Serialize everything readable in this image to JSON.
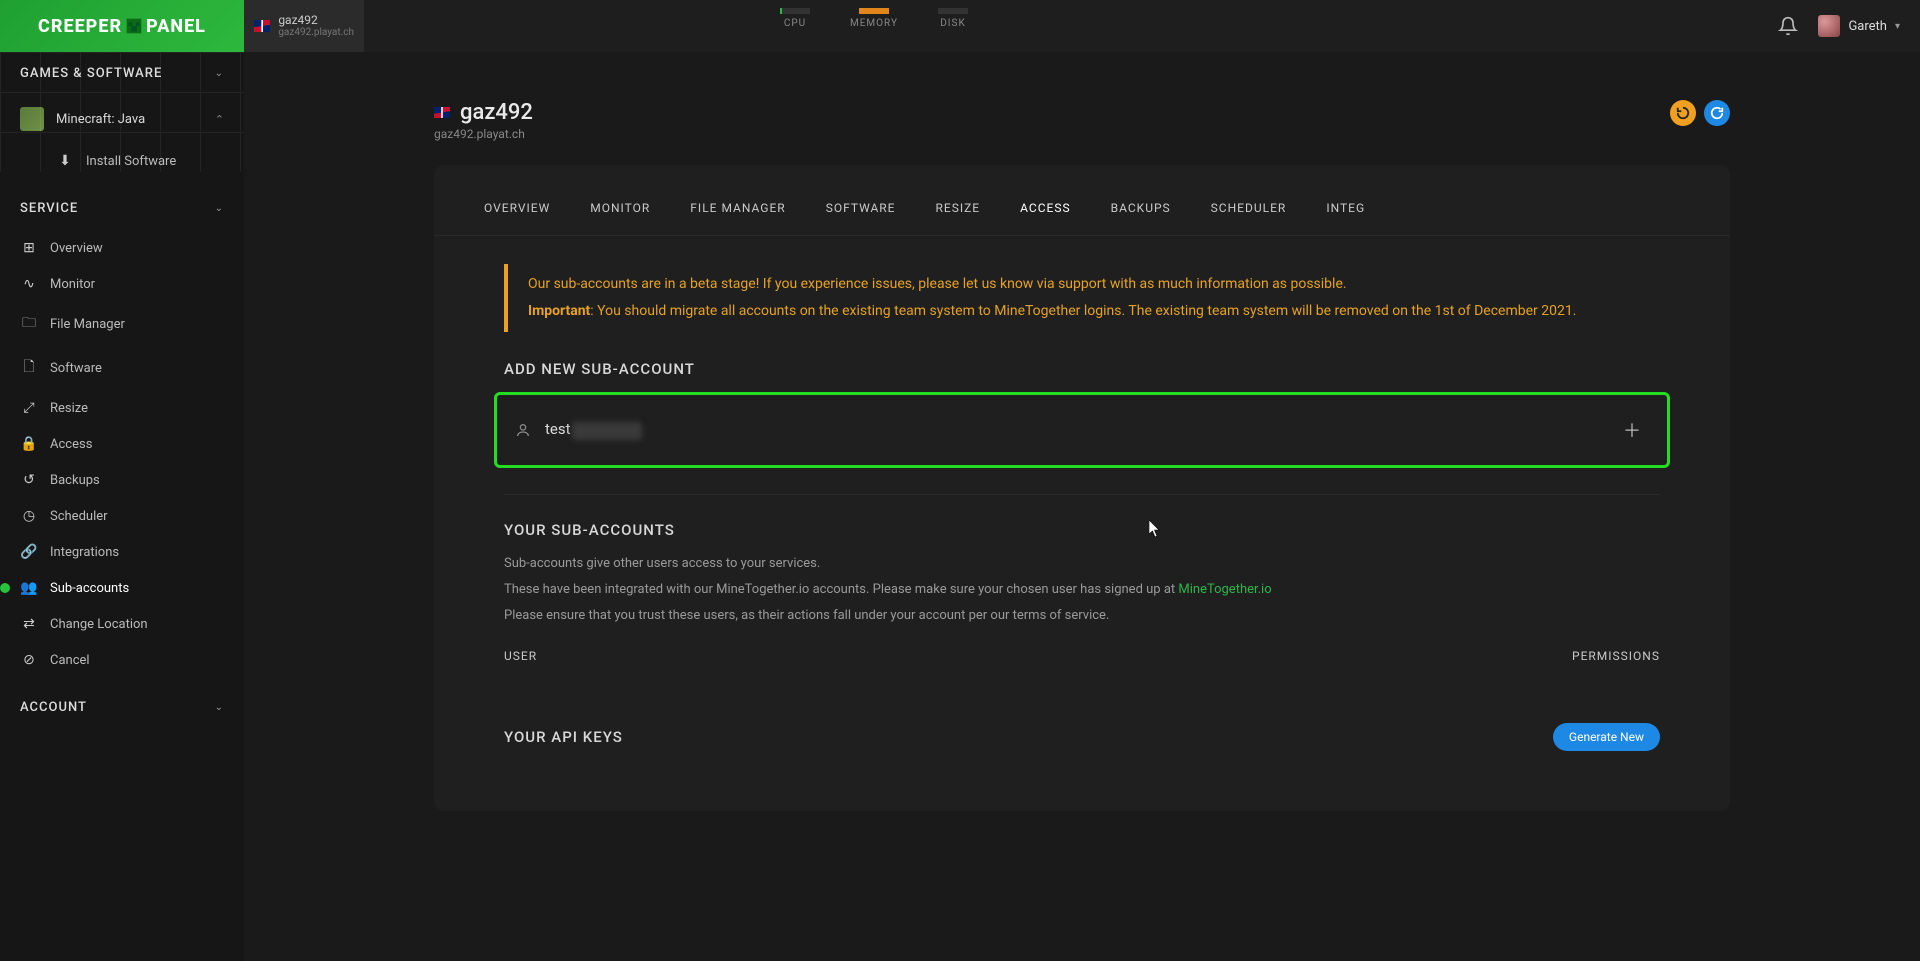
{
  "brand": {
    "part1": "CREEPER",
    "part2": "PANEL"
  },
  "serverChip": {
    "name": "gaz492",
    "address": "gaz492.playat.ch"
  },
  "metrics": {
    "cpu": "CPU",
    "memory": "MEMORY",
    "disk": "DISK"
  },
  "topUser": {
    "name": "Gareth"
  },
  "sidebar": {
    "sections": {
      "games": "GAMES & SOFTWARE",
      "service": "SERVICE",
      "account": "ACCOUNT"
    },
    "game": {
      "name": "Minecraft: Java"
    },
    "install": "Install Software",
    "service_items": [
      {
        "icon": "⊞",
        "label": "Overview",
        "name": "overview"
      },
      {
        "icon": "∿",
        "label": "Monitor",
        "name": "monitor"
      },
      {
        "icon": "🗀",
        "label": "File Manager",
        "name": "file-manager"
      },
      {
        "icon": "🗋",
        "label": "Software",
        "name": "software"
      },
      {
        "icon": "⤢",
        "label": "Resize",
        "name": "resize"
      },
      {
        "icon": "🔒",
        "label": "Access",
        "name": "access"
      },
      {
        "icon": "↺",
        "label": "Backups",
        "name": "backups"
      },
      {
        "icon": "◷",
        "label": "Scheduler",
        "name": "scheduler"
      },
      {
        "icon": "🔗",
        "label": "Integrations",
        "name": "integrations"
      },
      {
        "icon": "👥",
        "label": "Sub-accounts",
        "name": "sub-accounts",
        "active": true
      },
      {
        "icon": "⇄",
        "label": "Change Location",
        "name": "change-location"
      },
      {
        "icon": "⊘",
        "label": "Cancel",
        "name": "cancel"
      }
    ]
  },
  "mainHeader": {
    "title": "gaz492",
    "subtitle": "gaz492.playat.ch"
  },
  "tabs": [
    "OVERVIEW",
    "MONITOR",
    "FILE MANAGER",
    "SOFTWARE",
    "RESIZE",
    "ACCESS",
    "BACKUPS",
    "SCHEDULER",
    "INTEG"
  ],
  "activeTab": "ACCESS",
  "notice": {
    "line1": "Our sub-accounts are in a beta stage! If you experience issues, please let us know via support with as much information as possible.",
    "strong": "Important",
    "line2": ": You should migrate all accounts on the existing team system to MineTogether logins. The existing team system will be removed on the 1st of December 2021."
  },
  "addSection": {
    "title": "ADD NEW SUB-ACCOUNT",
    "typed_prefix": "test"
  },
  "listSection": {
    "title": "YOUR SUB-ACCOUNTS",
    "desc1": "Sub-accounts give other users access to your services.",
    "desc2a": "These have been integrated with our MineTogether.io accounts. Please make sure your chosen user has signed up at ",
    "desc2link": "MineTogether.io",
    "desc3": "Please ensure that you trust these users, as their actions fall under your account per our terms of service.",
    "col_user": "USER",
    "col_perm": "PERMISSIONS"
  },
  "apiSection": {
    "title": "YOUR API KEYS",
    "button": "Generate New"
  }
}
